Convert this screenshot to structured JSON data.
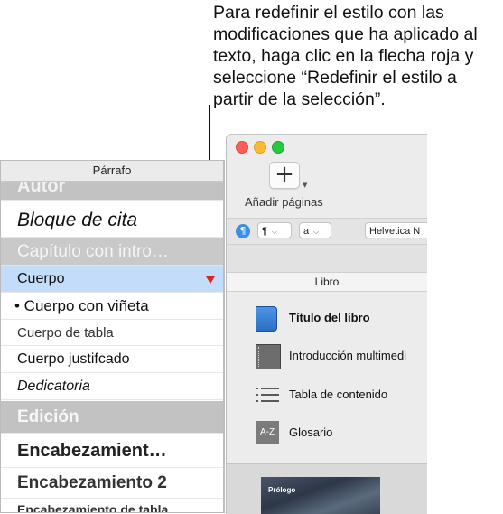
{
  "callout": {
    "lines": [
      "Para redefinir el estilo con las",
      "modificaciones que ha aplicado al",
      "texto, haga clic en la flecha roja y",
      "seleccione “Redefinir el estilo a",
      "partir de la selección”."
    ]
  },
  "toolbar": {
    "add_icon": "plus-icon",
    "add_label": "Añadir páginas",
    "paragraph_icon": "paragraph-icon",
    "paragraph_popup": "¶",
    "char_popup": "a",
    "font_popup": "Helvetica N"
  },
  "libro": {
    "header": "Libro",
    "items": [
      {
        "label": "Título del libro",
        "icon": "book-icon"
      },
      {
        "label": "Introducción multimedi",
        "icon": "film-icon"
      },
      {
        "label": "Tabla de contenido",
        "icon": "list-icon"
      },
      {
        "label": "Glosario",
        "icon": "az-icon",
        "icon_text": "A-Z"
      }
    ],
    "thumbnail_label": "Prólogo"
  },
  "panel": {
    "title": "Párrafo",
    "styles": [
      "Autor",
      "Bloque de cita",
      "Capítulo con intro…",
      "Cuerpo",
      "• Cuerpo con viñeta",
      "Cuerpo de tabla",
      "Cuerpo justifcado",
      "Dedicatoria",
      "Edición",
      "Encabezamient…",
      "Encabezamiento 2",
      "Encabezamiento de tabla"
    ],
    "selected_index": 3
  },
  "colors": {
    "selection": "#c3dcfa",
    "red_arrow": "#e02424",
    "accent_blue": "#3b8ee8"
  }
}
